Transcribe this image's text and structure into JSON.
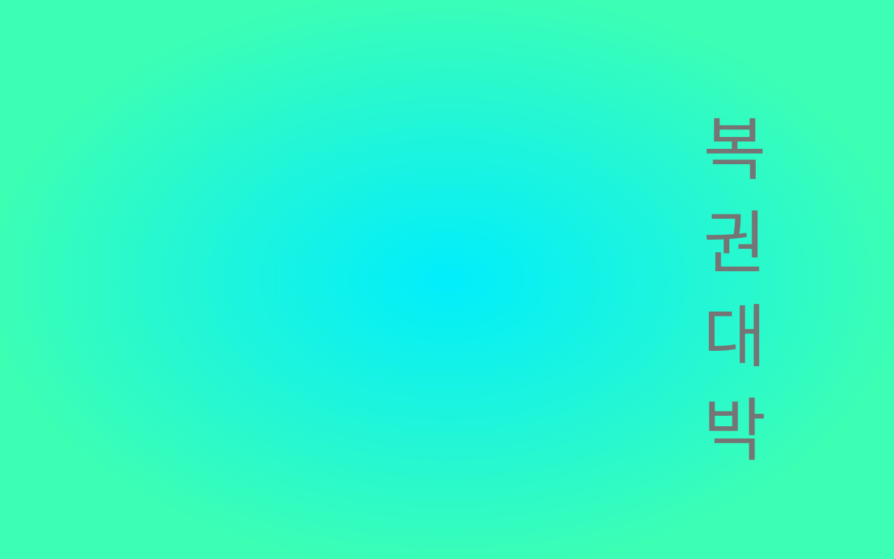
{
  "background": {
    "center_color": "#00eefc",
    "edge_color": "#3cffb4"
  },
  "text_color": "#757575",
  "vertical_text": {
    "characters": [
      "복",
      "권",
      "대",
      "박"
    ]
  }
}
